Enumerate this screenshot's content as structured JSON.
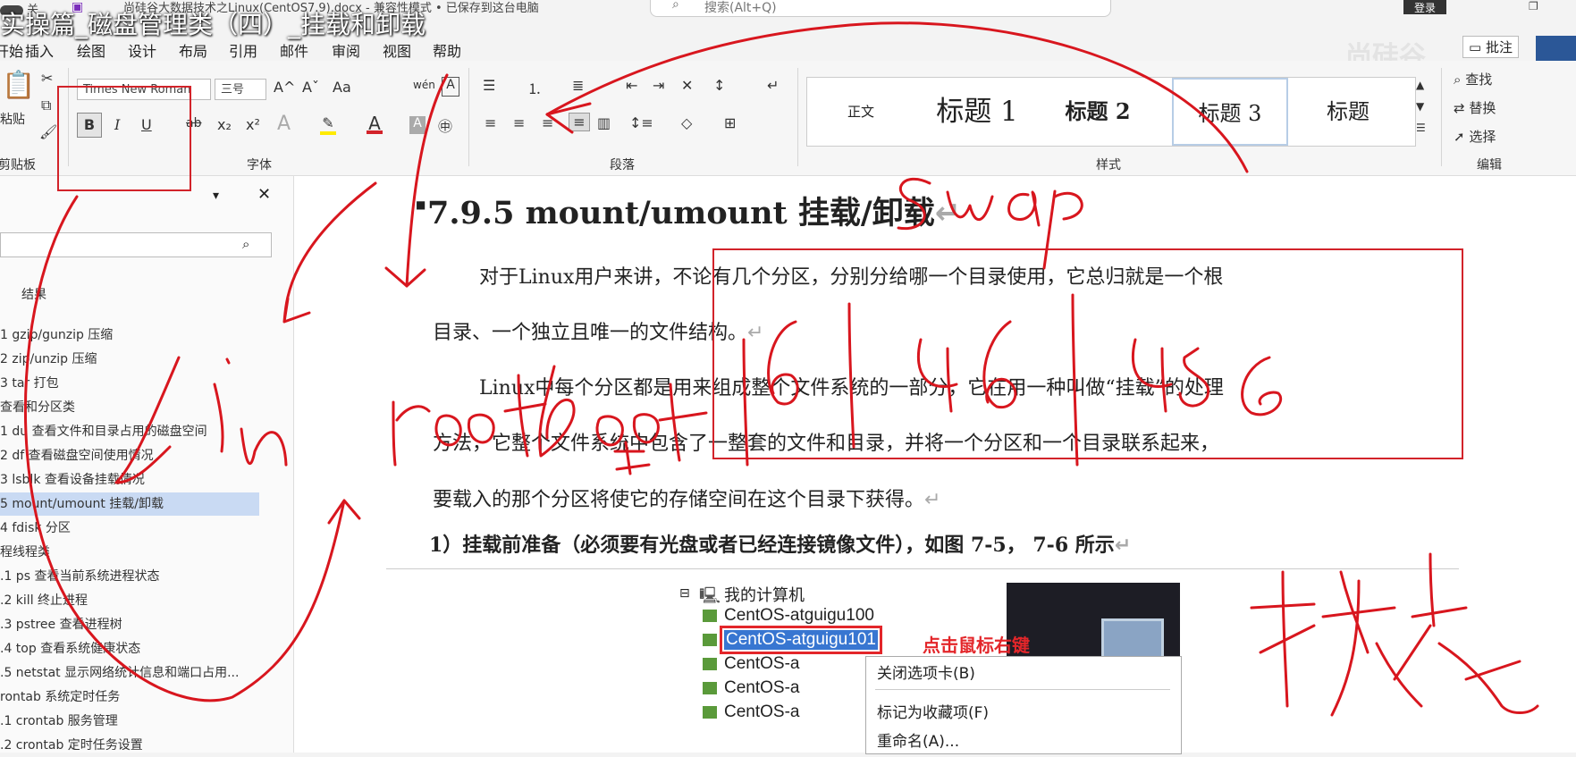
{
  "video_title": "实操篇_磁盘管理类（四）_挂载和卸载",
  "window": {
    "doc_title": "尚硅谷大数据技术之Linux(CentOS7.9).docx - 兼容性模式 • 已保存到这台电脑",
    "autosave_label": "关",
    "search_placeholder": "搜索(Alt+Q)",
    "login_label": "登录"
  },
  "menu": {
    "tabs": [
      "开始",
      "插入",
      "绘图",
      "设计",
      "布局",
      "引用",
      "邮件",
      "审阅",
      "视图",
      "帮助"
    ],
    "comment_label": "批注"
  },
  "watermark": "尚硅谷",
  "ribbon": {
    "clipboard": {
      "paste_label": "粘贴",
      "group_label": "剪贴板"
    },
    "font": {
      "font_name": "Times New Roman",
      "font_size": "三号",
      "group_label": "字体",
      "bold": "B",
      "italic": "I",
      "underline": "U",
      "strike": "ab",
      "subscript": "x₂",
      "superscript": "x²",
      "grow": "A^",
      "shrink": "Aˇ",
      "case": "Aa",
      "phonetic": "wén",
      "border": "A"
    },
    "paragraph": {
      "group_label": "段落"
    },
    "styles": {
      "items": [
        "正文",
        "标题 1",
        "标题 2",
        "标题 3",
        "标题"
      ],
      "group_label": "样式"
    },
    "editing": {
      "find": "查找",
      "replace": "替换",
      "select": "选择",
      "group_label": "编辑"
    }
  },
  "navpane": {
    "tab_results": "结果",
    "items": [
      {
        "label": "1 gzip/gunzip 压缩",
        "active": false
      },
      {
        "label": "2 zip/unzip 压缩",
        "active": false
      },
      {
        "label": "3 tar 打包",
        "active": false
      },
      {
        "label": "查看和分区类",
        "active": false
      },
      {
        "label": "1 du 查看文件和目录占用的磁盘空间",
        "active": false
      },
      {
        "label": "2 df 查看磁盘空间使用情况",
        "active": false
      },
      {
        "label": "3 lsblk 查看设备挂载情况",
        "active": false
      },
      {
        "label": "5 mount/umount 挂载/卸载",
        "active": true
      },
      {
        "label": "4 fdisk 分区",
        "active": false
      },
      {
        "label": "程线程类",
        "active": false
      },
      {
        "label": ".1 ps 查看当前系统进程状态",
        "active": false
      },
      {
        "label": ".2 kill 终止进程",
        "active": false
      },
      {
        "label": ".3 pstree 查看进程树",
        "active": false
      },
      {
        "label": ".4 top 查看系统健康状态",
        "active": false
      },
      {
        "label": ".5 netstat 显示网络统计信息和端口占用...",
        "active": false
      },
      {
        "label": "rontab 系统定时任务",
        "active": false
      },
      {
        "label": ".1 crontab 服务管理",
        "active": false
      },
      {
        "label": ".2 crontab 定时任务设置",
        "active": false
      }
    ]
  },
  "document": {
    "heading": "7.9.5 mount/umount 挂载/卸载",
    "p1_line1": "对于Linux用户来讲，不论有几个分区，分别分给哪一个目录使用，它总归就是一个根",
    "p1_line2": "目录、一个独立且唯一的文件结构。",
    "p2_line1": "Linux中每个分区都是用来组成整个文件系统的一部分，它在用一种叫做“挂载”的处理",
    "p2_line2": "方法，它整个文件系统中包含了一整套的文件和目录，并将一个分区和一个目录联系起来，",
    "p2_line3": "要载入的那个分区将使它的存储空间在这个目录下获得。",
    "step1": "1）挂载前准备（必须要有光盘或者已经连接镜像文件），如图 7-5， 7-6 所示",
    "pilcrow": "↵"
  },
  "screenshot": {
    "tree_root": "我的计算机",
    "vms": [
      "CentOS-atguigu100",
      "CentOS-atguigu101",
      "CentOS-a",
      "CentOS-a",
      "CentOS-a"
    ],
    "callout": "点击鼠标右键",
    "context_menu": [
      "关闭选项卡(B)",
      "标记为收藏项(F)",
      "重命名(A)..."
    ]
  },
  "handwriting": {
    "words": [
      "swap",
      "bin",
      "root",
      "boot",
      "1G",
      "4G",
      "45G",
      "挂载点"
    ]
  }
}
